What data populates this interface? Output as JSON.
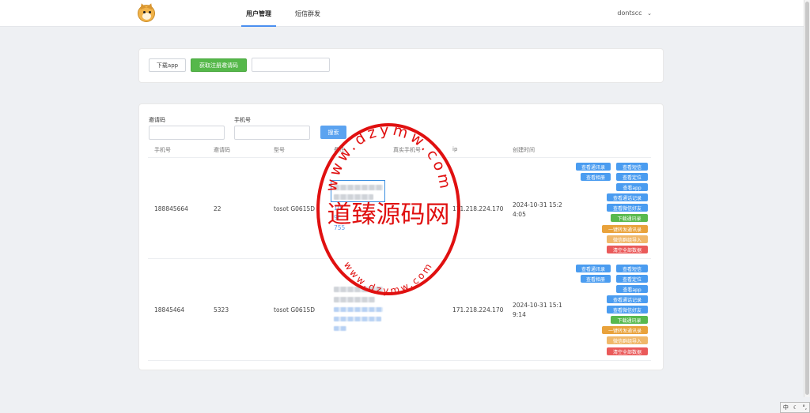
{
  "header": {
    "tabs": [
      {
        "label": "用户管理",
        "active": true
      },
      {
        "label": "短信群发",
        "active": false
      }
    ],
    "username": "dontscc"
  },
  "toolbar": {
    "download_app_label": "下载app",
    "get_invite_code_label": "获取注册邀请码",
    "invite_code_value": ""
  },
  "filters": {
    "invite_code_label": "邀请码",
    "phone_label": "手机号",
    "search_label": "搜索"
  },
  "table": {
    "columns": [
      "手机号",
      "邀请码",
      "型号",
      "备注",
      "真实手机号",
      "ip",
      "创建时间"
    ],
    "rows": [
      {
        "phone": "188845664",
        "invite_code": "22",
        "model": "tosot G0615D",
        "note_partial_1": "10",
        "note_partial_2": "9/",
        "note_partial_3": "755",
        "real_phone": "",
        "ip": "171.218.224.170",
        "created_line1": "2024-10-31 15:2",
        "created_line2": "4:05"
      },
      {
        "phone": "18845464",
        "invite_code": "5323",
        "model": "tosot G0615D",
        "real_phone": "",
        "ip": "171.218.224.170",
        "created_line1": "2024-10-31 15:1",
        "created_line2": "9:14"
      }
    ],
    "actions": {
      "view_contacts": "查看通讯录",
      "view_sms": "查看短信",
      "view_album": "查看相册",
      "view_location": "查看定位",
      "view_app": "查看app",
      "view_call_log": "查看通话记录",
      "view_wechat_friends": "查看微信好友",
      "download_contacts": "下载通讯录",
      "forward_contacts": "一键转发通讯录",
      "wechat_import": "微信群组导入",
      "clear_all": "清空全部数据"
    }
  },
  "watermark": {
    "top_arc": "www.dzymw.com",
    "center_text": "道臻源码网",
    "bottom_arc": "www.dzymw.com",
    "color": "#e01010"
  },
  "ime": {
    "label": "中"
  }
}
